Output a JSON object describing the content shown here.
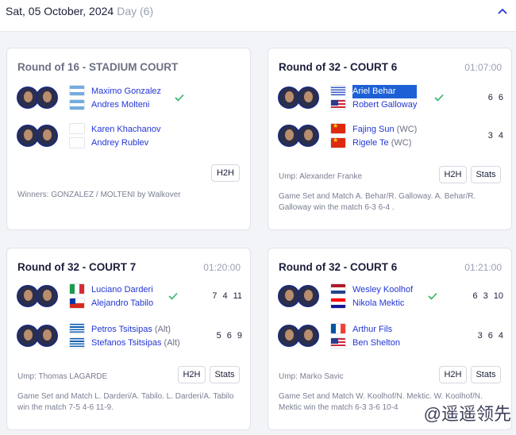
{
  "day_header": {
    "date": "Sat, 05 October, 2024",
    "day": "Day (6)"
  },
  "matches": [
    {
      "round": "Round of 16 - STADIUM COURT",
      "time": "",
      "teams": [
        {
          "players": [
            {
              "name": "Maximo Gonzalez",
              "flag": "ARG"
            },
            {
              "name": "Andres Molteni",
              "flag": "ARG"
            }
          ],
          "winner": true,
          "scores": []
        },
        {
          "players": [
            {
              "name": "Karen Khachanov",
              "flag": ""
            },
            {
              "name": "Andrey Rublev",
              "flag": ""
            }
          ],
          "winner": false,
          "scores": []
        }
      ],
      "h2h_label": "H2H",
      "footer": "Winners: GONZALEZ / MOLTENI by Walkover"
    },
    {
      "round": "Round of 32 - COURT 6",
      "time": "01:07:00",
      "teams": [
        {
          "players": [
            {
              "name": "Ariel Behar",
              "flag": "URU"
            },
            {
              "name": "Robert Galloway",
              "flag": "USA"
            }
          ],
          "winner": true,
          "scores": [
            "6",
            "6"
          ]
        },
        {
          "players": [
            {
              "name": "Fajing Sun",
              "tag": "(WC)",
              "flag": "CHN"
            },
            {
              "name": "Rigele Te",
              "tag": "(WC)",
              "flag": "CHN"
            }
          ],
          "winner": false,
          "scores": [
            "3",
            "4"
          ]
        }
      ],
      "umpire": "Ump: Alexander Franke",
      "h2h_label": "H2H",
      "stats_label": "Stats",
      "summary": "Game Set and Match A. Behar/R. Galloway. A. Behar/R. Galloway win the match 6-3 6-4 ."
    },
    {
      "round": "Round of 32 - COURT 7",
      "time": "01:20:00",
      "teams": [
        {
          "players": [
            {
              "name": "Luciano Darderi",
              "flag": "ITA"
            },
            {
              "name": "Alejandro Tabilo",
              "flag": "CHI"
            }
          ],
          "winner": true,
          "scores": [
            "7",
            "4",
            "11"
          ]
        },
        {
          "players": [
            {
              "name": "Petros Tsitsipas",
              "tag": "(Alt)",
              "flag": "GRE"
            },
            {
              "name": "Stefanos Tsitsipas",
              "tag": "(Alt)",
              "flag": "GRE"
            }
          ],
          "winner": false,
          "scores": [
            "5",
            "6",
            "9"
          ]
        }
      ],
      "umpire": "Ump: Thomas LAGARDE",
      "h2h_label": "H2H",
      "stats_label": "Stats",
      "summary": "Game Set and Match L. Darderi/A. Tabilo. L. Darderi/A. Tabilo win the match 7-5 4-6 11-9."
    },
    {
      "round": "Round of 32 - COURT 6",
      "time": "01:21:00",
      "teams": [
        {
          "players": [
            {
              "name": "Wesley Koolhof",
              "flag": "NED"
            },
            {
              "name": "Nikola Mektic",
              "flag": "CRO"
            }
          ],
          "winner": true,
          "scores": [
            "6",
            "3",
            "10"
          ]
        },
        {
          "players": [
            {
              "name": "Arthur Fils",
              "flag": "FRA"
            },
            {
              "name": "Ben Shelton",
              "flag": "USA"
            }
          ],
          "winner": false,
          "scores": [
            "3",
            "6",
            "4"
          ]
        }
      ],
      "umpire": "Ump: Marko Savic",
      "h2h_label": "H2H",
      "stats_label": "Stats",
      "summary": "Game Set and Match W. Koolhof/N. Mektic. W. Koolhof/N. Mektic win the match 6-3 3-6 10-4"
    }
  ],
  "watermark": "@遥遥领先",
  "colors": {
    "link": "#2236d4",
    "check": "#2fb463",
    "selected": "#1d60d6"
  }
}
